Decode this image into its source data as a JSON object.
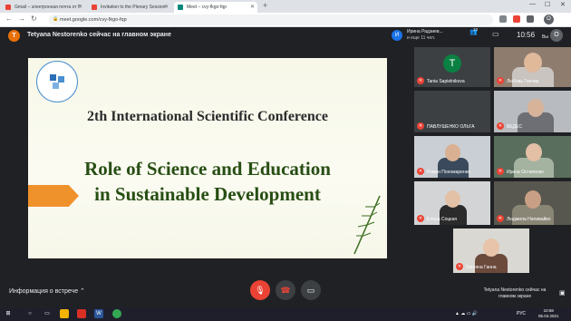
{
  "browser": {
    "tabs": [
      {
        "title": "Gmail – электронная почта от Г",
        "color": "#ea4335",
        "active": false
      },
      {
        "title": "Invitation to the Plenary Session",
        "color": "#ea4335",
        "active": false
      },
      {
        "title": "Meet – cvy-fkgo-fqp",
        "color": "#00897b",
        "active": true
      }
    ],
    "new_tab": "+",
    "url": "meet.google.com/cvy-fkgo-fqp",
    "profile_initial": "O"
  },
  "meet": {
    "presenter_initial": "T",
    "presenter_title": "Tetyana Nestorenko сейчас на главном экране",
    "user_initial": "И",
    "user_name": "Ирина Радзиев...",
    "user_more": "и еще 11 чел.",
    "people_count": "23",
    "time": "10:56",
    "you_label": "Вы",
    "you_initial": "O"
  },
  "slide": {
    "logo_text": "WYŻSZA SZKOŁA TECHNICZNA W KATOWICACH",
    "subtitle": "2th International Scientific Conference",
    "title_line1": "Role of Science and Education",
    "title_line2": "in Sustainable Development"
  },
  "participants": [
    {
      "name": "Tania Sapielnikova",
      "initial": "T"
    },
    {
      "name": "Любовь Гончар"
    },
    {
      "name": "ПАВЛУШЕНКО ОЛЬГА"
    },
    {
      "name": "ВЕДЕС"
    },
    {
      "name": "Роман Пономаренко"
    },
    {
      "name": "Ирина Остапенко"
    },
    {
      "name": "Елена Соцкая"
    },
    {
      "name": "Людмила Наливайко"
    },
    {
      "name": "Татьяна Ганна"
    }
  ],
  "bottom": {
    "meeting_info": "Информация о встрече",
    "mic_icon": "mic-off",
    "end_icon": "call-end",
    "cam_icon": "camera",
    "presenting_text": "Tetyana Nestorenko сейчас на главном экране"
  },
  "taskbar": {
    "lang": "РУС",
    "clock_time": "10:56",
    "clock_date": "05.04.2021"
  },
  "colors": {
    "meet_bg": "#202124",
    "tile_bg": "#3c4043",
    "end_call": "#ea4335",
    "slide_title": "#274e13",
    "arrow": "#f0922b"
  }
}
